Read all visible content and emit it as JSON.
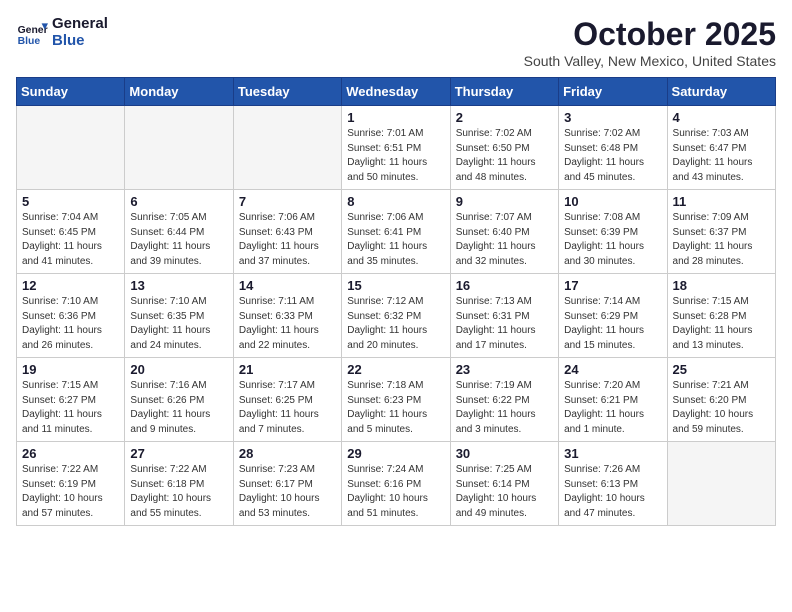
{
  "logo": {
    "line1": "General",
    "line2": "Blue"
  },
  "title": "October 2025",
  "location": "South Valley, New Mexico, United States",
  "weekdays": [
    "Sunday",
    "Monday",
    "Tuesday",
    "Wednesday",
    "Thursday",
    "Friday",
    "Saturday"
  ],
  "weeks": [
    [
      {
        "day": "",
        "detail": ""
      },
      {
        "day": "",
        "detail": ""
      },
      {
        "day": "",
        "detail": ""
      },
      {
        "day": "1",
        "detail": "Sunrise: 7:01 AM\nSunset: 6:51 PM\nDaylight: 11 hours\nand 50 minutes."
      },
      {
        "day": "2",
        "detail": "Sunrise: 7:02 AM\nSunset: 6:50 PM\nDaylight: 11 hours\nand 48 minutes."
      },
      {
        "day": "3",
        "detail": "Sunrise: 7:02 AM\nSunset: 6:48 PM\nDaylight: 11 hours\nand 45 minutes."
      },
      {
        "day": "4",
        "detail": "Sunrise: 7:03 AM\nSunset: 6:47 PM\nDaylight: 11 hours\nand 43 minutes."
      }
    ],
    [
      {
        "day": "5",
        "detail": "Sunrise: 7:04 AM\nSunset: 6:45 PM\nDaylight: 11 hours\nand 41 minutes."
      },
      {
        "day": "6",
        "detail": "Sunrise: 7:05 AM\nSunset: 6:44 PM\nDaylight: 11 hours\nand 39 minutes."
      },
      {
        "day": "7",
        "detail": "Sunrise: 7:06 AM\nSunset: 6:43 PM\nDaylight: 11 hours\nand 37 minutes."
      },
      {
        "day": "8",
        "detail": "Sunrise: 7:06 AM\nSunset: 6:41 PM\nDaylight: 11 hours\nand 35 minutes."
      },
      {
        "day": "9",
        "detail": "Sunrise: 7:07 AM\nSunset: 6:40 PM\nDaylight: 11 hours\nand 32 minutes."
      },
      {
        "day": "10",
        "detail": "Sunrise: 7:08 AM\nSunset: 6:39 PM\nDaylight: 11 hours\nand 30 minutes."
      },
      {
        "day": "11",
        "detail": "Sunrise: 7:09 AM\nSunset: 6:37 PM\nDaylight: 11 hours\nand 28 minutes."
      }
    ],
    [
      {
        "day": "12",
        "detail": "Sunrise: 7:10 AM\nSunset: 6:36 PM\nDaylight: 11 hours\nand 26 minutes."
      },
      {
        "day": "13",
        "detail": "Sunrise: 7:10 AM\nSunset: 6:35 PM\nDaylight: 11 hours\nand 24 minutes."
      },
      {
        "day": "14",
        "detail": "Sunrise: 7:11 AM\nSunset: 6:33 PM\nDaylight: 11 hours\nand 22 minutes."
      },
      {
        "day": "15",
        "detail": "Sunrise: 7:12 AM\nSunset: 6:32 PM\nDaylight: 11 hours\nand 20 minutes."
      },
      {
        "day": "16",
        "detail": "Sunrise: 7:13 AM\nSunset: 6:31 PM\nDaylight: 11 hours\nand 17 minutes."
      },
      {
        "day": "17",
        "detail": "Sunrise: 7:14 AM\nSunset: 6:29 PM\nDaylight: 11 hours\nand 15 minutes."
      },
      {
        "day": "18",
        "detail": "Sunrise: 7:15 AM\nSunset: 6:28 PM\nDaylight: 11 hours\nand 13 minutes."
      }
    ],
    [
      {
        "day": "19",
        "detail": "Sunrise: 7:15 AM\nSunset: 6:27 PM\nDaylight: 11 hours\nand 11 minutes."
      },
      {
        "day": "20",
        "detail": "Sunrise: 7:16 AM\nSunset: 6:26 PM\nDaylight: 11 hours\nand 9 minutes."
      },
      {
        "day": "21",
        "detail": "Sunrise: 7:17 AM\nSunset: 6:25 PM\nDaylight: 11 hours\nand 7 minutes."
      },
      {
        "day": "22",
        "detail": "Sunrise: 7:18 AM\nSunset: 6:23 PM\nDaylight: 11 hours\nand 5 minutes."
      },
      {
        "day": "23",
        "detail": "Sunrise: 7:19 AM\nSunset: 6:22 PM\nDaylight: 11 hours\nand 3 minutes."
      },
      {
        "day": "24",
        "detail": "Sunrise: 7:20 AM\nSunset: 6:21 PM\nDaylight: 11 hours\nand 1 minute."
      },
      {
        "day": "25",
        "detail": "Sunrise: 7:21 AM\nSunset: 6:20 PM\nDaylight: 10 hours\nand 59 minutes."
      }
    ],
    [
      {
        "day": "26",
        "detail": "Sunrise: 7:22 AM\nSunset: 6:19 PM\nDaylight: 10 hours\nand 57 minutes."
      },
      {
        "day": "27",
        "detail": "Sunrise: 7:22 AM\nSunset: 6:18 PM\nDaylight: 10 hours\nand 55 minutes."
      },
      {
        "day": "28",
        "detail": "Sunrise: 7:23 AM\nSunset: 6:17 PM\nDaylight: 10 hours\nand 53 minutes."
      },
      {
        "day": "29",
        "detail": "Sunrise: 7:24 AM\nSunset: 6:16 PM\nDaylight: 10 hours\nand 51 minutes."
      },
      {
        "day": "30",
        "detail": "Sunrise: 7:25 AM\nSunset: 6:14 PM\nDaylight: 10 hours\nand 49 minutes."
      },
      {
        "day": "31",
        "detail": "Sunrise: 7:26 AM\nSunset: 6:13 PM\nDaylight: 10 hours\nand 47 minutes."
      },
      {
        "day": "",
        "detail": ""
      }
    ]
  ]
}
